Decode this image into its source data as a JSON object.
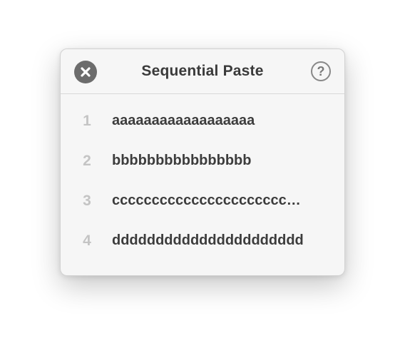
{
  "panel": {
    "title": "Sequential Paste",
    "close_icon": "close-circle-icon",
    "help_label": "?",
    "help_icon": "question-circle-icon"
  },
  "items": [
    {
      "number": "1",
      "text": "aaaaaaaaaaaaaaaaaa"
    },
    {
      "number": "2",
      "text": "bbbbbbbbbbbbbbbb"
    },
    {
      "number": "3",
      "text": "cccccccccccccccccccccc…"
    },
    {
      "number": "4",
      "text": "dddddddddddddddddddddd"
    }
  ],
  "colors": {
    "panel_bg": "#f6f6f6",
    "close_bg": "#6c6c6c",
    "number": "#c4c4c4",
    "text": "#3c3c3c"
  }
}
